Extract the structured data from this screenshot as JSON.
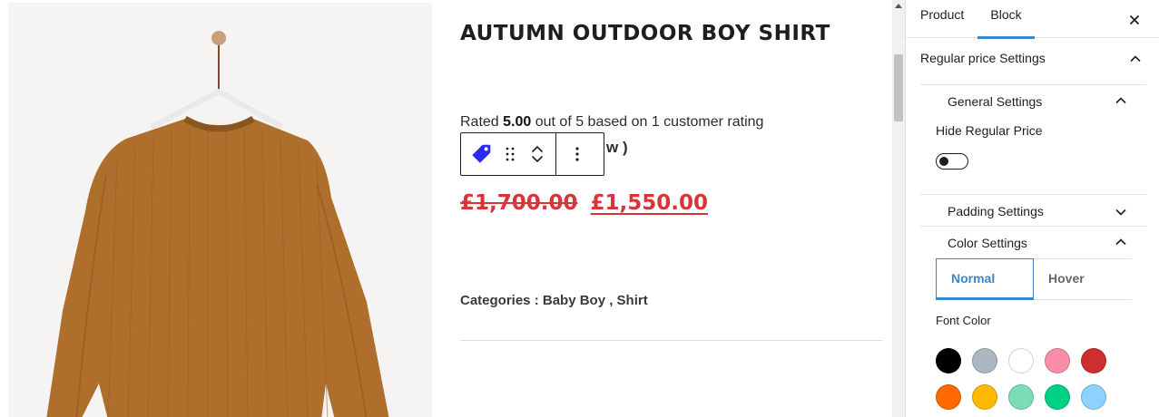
{
  "product": {
    "title": "AUTUMN OUTDOOR BOY SHIRT",
    "rating_prefix": "Rated ",
    "rating_value": "5.00",
    "rating_suffix": " out of 5 based on 1 customer rating",
    "review_tail": "w )",
    "price_old": "£1,700.00",
    "price_new": "£1,550.00",
    "categories": "Categories : Baby Boy , Shirt"
  },
  "toolbar": {
    "block_icon": "tag-icon",
    "drag_icon": "drag-handle-icon",
    "move_up_icon": "chevron-up-icon",
    "move_down_icon": "chevron-down-icon",
    "more_icon": "more-vertical-icon"
  },
  "sidebar": {
    "tabs": [
      {
        "label": "Product"
      },
      {
        "label": "Block"
      }
    ],
    "section_title": "Regular price Settings",
    "general_settings": "General Settings",
    "hide_regular_price_label": "Hide Regular Price",
    "hide_regular_price_enabled": false,
    "padding_settings": "Padding Settings",
    "color_settings": "Color Settings",
    "state_tabs": [
      "Normal",
      "Hover"
    ],
    "font_color_label": "Font Color",
    "swatches": [
      "#000000",
      "#abb8c3",
      "#ffffff",
      "#f78da7",
      "#cf2e2e",
      "#ff6900",
      "#fcb900",
      "#7bdcb5",
      "#00d084",
      "#8ed1fc"
    ]
  },
  "colors": {
    "accent": "#3b86c8",
    "price": "#d63638",
    "tag_icon": "#2b2bf5"
  }
}
